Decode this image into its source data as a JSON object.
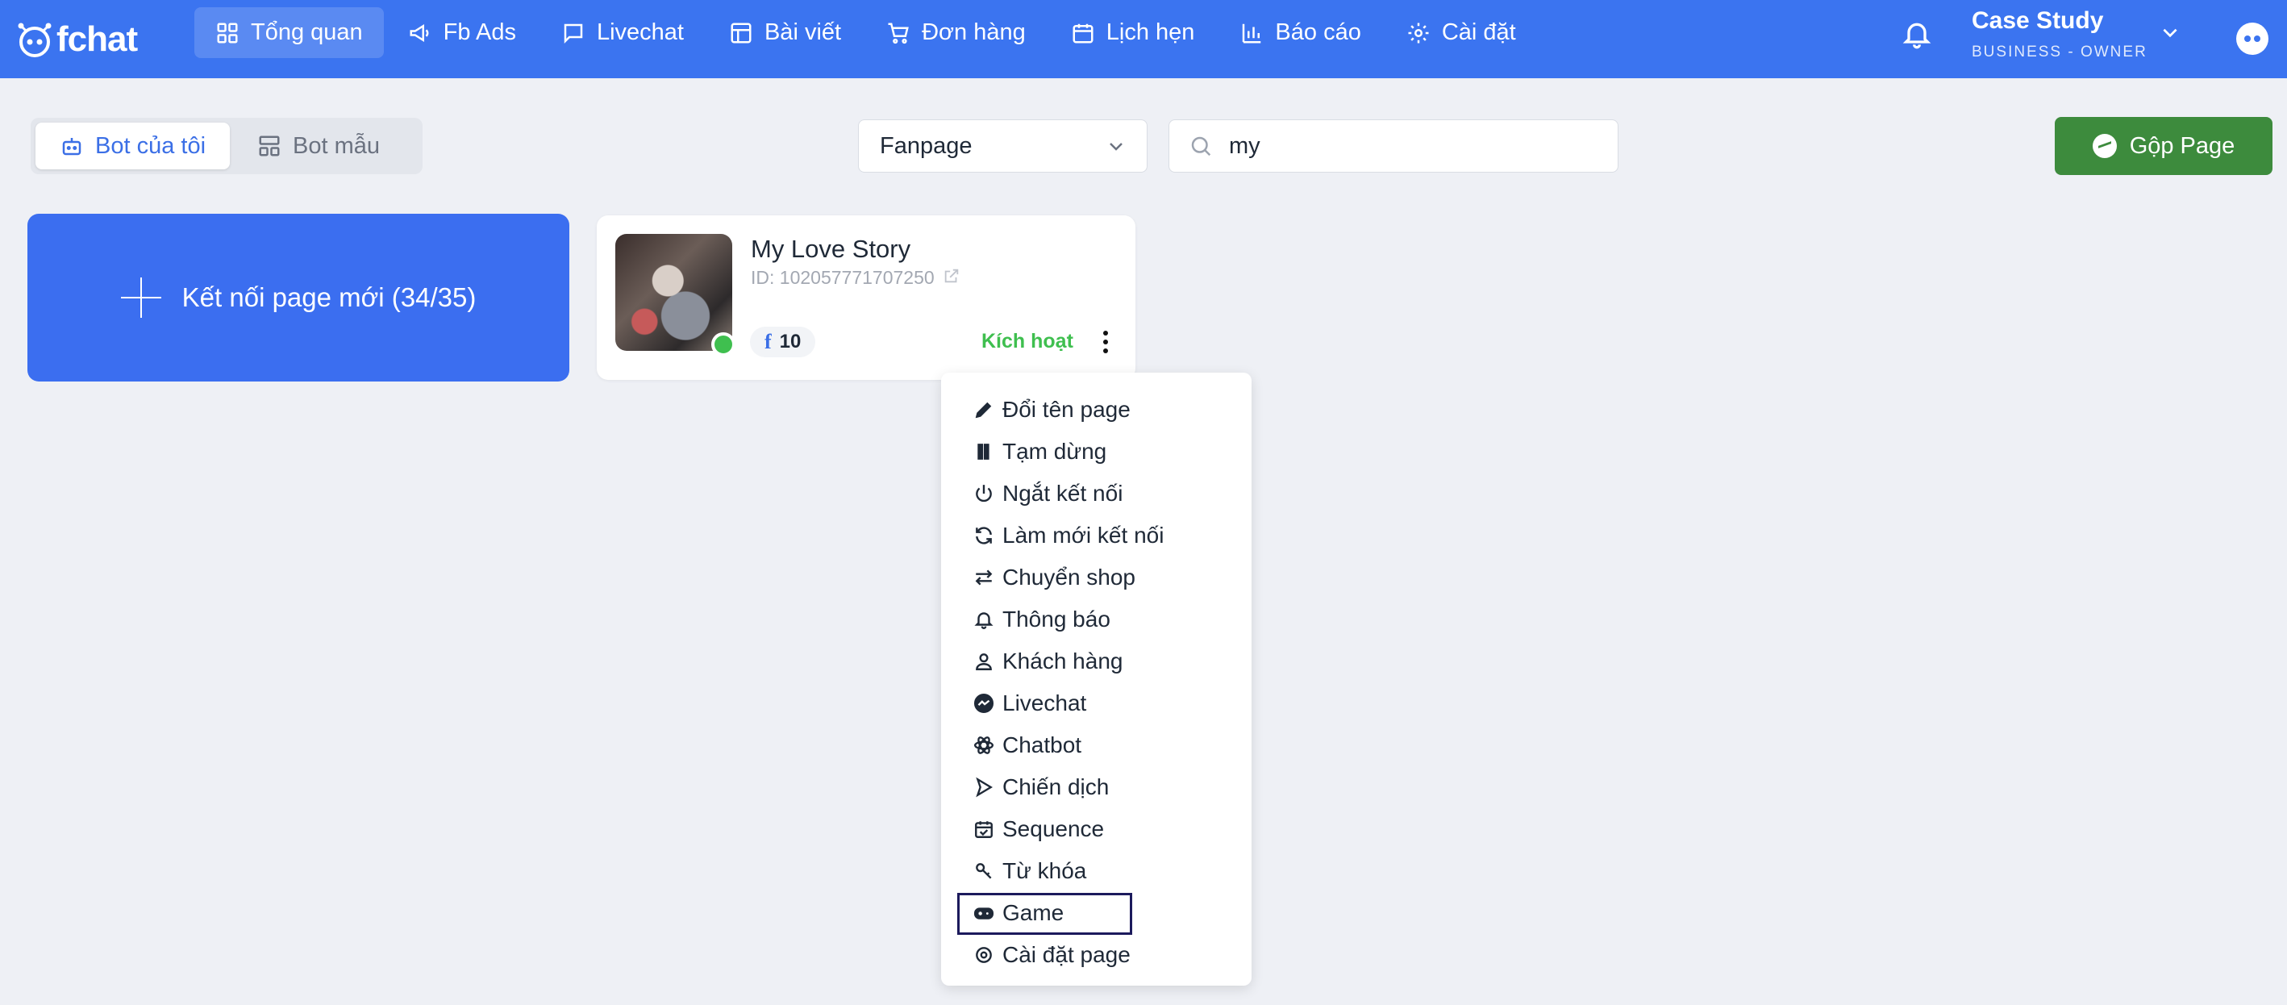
{
  "brand": {
    "name": "fchat"
  },
  "nav": {
    "items": [
      {
        "label": "Tổng quan",
        "icon": "dashboard-icon",
        "active": true
      },
      {
        "label": "Fb Ads",
        "icon": "megaphone-icon",
        "active": false
      },
      {
        "label": "Livechat",
        "icon": "chat-bubble-icon",
        "active": false
      },
      {
        "label": "Bài viết",
        "icon": "layout-icon",
        "active": false
      },
      {
        "label": "Đơn hàng",
        "icon": "cart-icon",
        "active": false
      },
      {
        "label": "Lịch hẹn",
        "icon": "calendar-icon",
        "active": false
      },
      {
        "label": "Báo cáo",
        "icon": "bar-chart-icon",
        "active": false
      },
      {
        "label": "Cài đặt",
        "icon": "gear-icon",
        "active": false
      }
    ]
  },
  "account": {
    "name": "Case Study",
    "role": "BUSINESS - OWNER"
  },
  "toolbar": {
    "tabs": [
      {
        "label": "Bot của tôi",
        "icon": "robot-icon",
        "active": true
      },
      {
        "label": "Bot mẫu",
        "icon": "template-icon",
        "active": false
      }
    ],
    "filter_select": {
      "value": "Fanpage"
    },
    "search": {
      "value": "my",
      "placeholder": ""
    },
    "merge_button": "Gộp Page"
  },
  "connect_card": {
    "label": "Kết nối page mới (34/35)"
  },
  "page_card": {
    "name": "My Love Story",
    "id_text": "ID: 102057771707250",
    "fb_count": "10",
    "status": "Kích hoạt"
  },
  "menu": {
    "items": [
      {
        "label": "Đổi tên page",
        "icon": "pencil-icon"
      },
      {
        "label": "Tạm dừng",
        "icon": "pause-icon"
      },
      {
        "label": "Ngắt kết nối",
        "icon": "power-icon"
      },
      {
        "label": "Làm mới kết nối",
        "icon": "refresh-icon"
      },
      {
        "label": "Chuyển shop",
        "icon": "swap-icon"
      },
      {
        "label": "Thông báo",
        "icon": "bell-icon"
      },
      {
        "label": "Khách hàng",
        "icon": "user-icon"
      },
      {
        "label": "Livechat",
        "icon": "messenger-icon"
      },
      {
        "label": "Chatbot",
        "icon": "atom-icon"
      },
      {
        "label": "Chiến dịch",
        "icon": "send-icon"
      },
      {
        "label": "Sequence",
        "icon": "calendar-check-icon"
      },
      {
        "label": "Từ khóa",
        "icon": "key-icon"
      },
      {
        "label": "Game",
        "icon": "gamepad-icon",
        "selected": true
      },
      {
        "label": "Cài đặt page",
        "icon": "gear-icon"
      }
    ]
  },
  "colors": {
    "primary": "#3b74f0",
    "success": "#3fbf4f",
    "merge_button": "#3d8b3d",
    "background": "#eef0f5"
  }
}
